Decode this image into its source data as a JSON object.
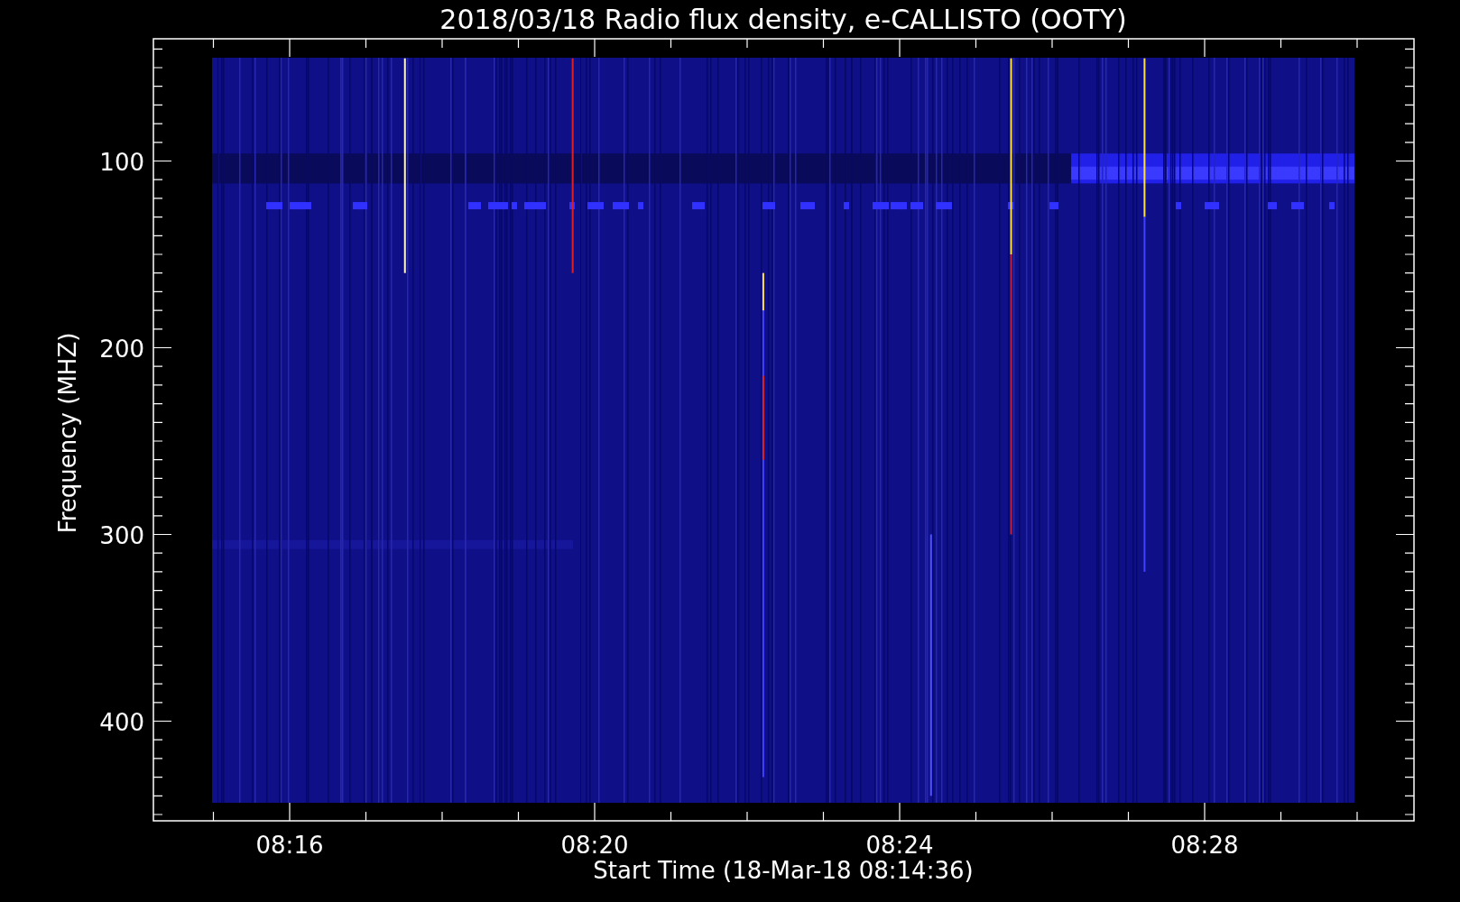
{
  "title": "2018/03/18  Radio flux density, e-CALLISTO (OOTY)",
  "y_axis": {
    "label": "Frequency (MHZ)",
    "ticks": [
      "100",
      "200",
      "300",
      "400"
    ]
  },
  "x_axis": {
    "label": "Start Time (18-Mar-18 08:14:36)",
    "ticks": [
      "08:16",
      "08:20",
      "08:24",
      "08:28"
    ]
  }
}
